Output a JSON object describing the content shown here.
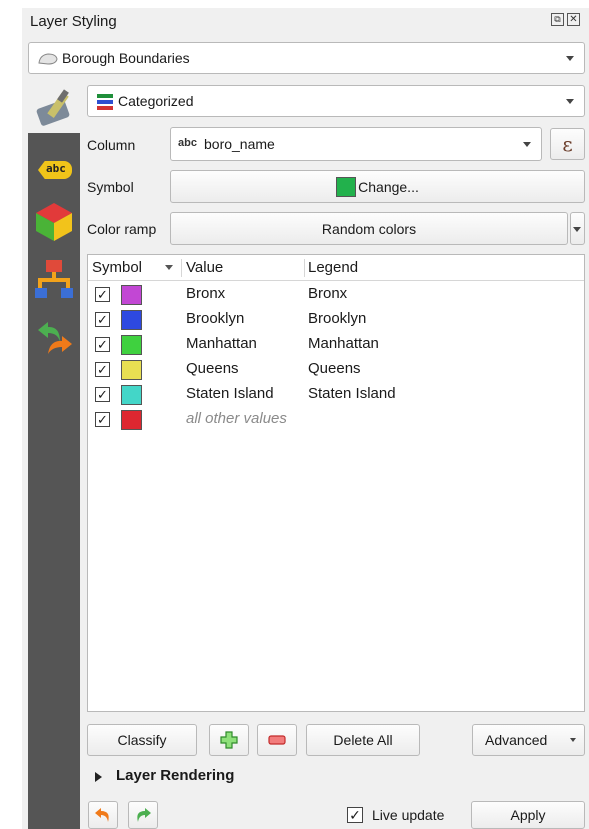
{
  "panel": {
    "title": "Layer Styling"
  },
  "layer_select": {
    "value": "Borough Boundaries"
  },
  "renderer_select": {
    "value": "Categorized"
  },
  "column": {
    "label": "Column",
    "type_tag": "abc",
    "value": "boro_name",
    "expr_symbol": "ε"
  },
  "symbol": {
    "label": "Symbol",
    "change_label": "Change...",
    "color": "#22b14c"
  },
  "color_ramp": {
    "label": "Color ramp",
    "value": "Random colors"
  },
  "side_tabs": [
    {
      "icon": "labels-abc-icon",
      "text": "abc"
    },
    {
      "icon": "3d-cube-icon"
    },
    {
      "icon": "diagram-icon"
    },
    {
      "icon": "history-arrows-icon"
    }
  ],
  "table": {
    "headers": [
      "Symbol",
      "Value",
      "Legend"
    ],
    "rows": [
      {
        "checked": true,
        "color": "#c247d4",
        "value": "Bronx",
        "legend": "Bronx"
      },
      {
        "checked": true,
        "color": "#2e49e0",
        "value": "Brooklyn",
        "legend": "Brooklyn"
      },
      {
        "checked": true,
        "color": "#3fd13f",
        "value": "Manhattan",
        "legend": "Manhattan"
      },
      {
        "checked": true,
        "color": "#e8df52",
        "value": "Queens",
        "legend": "Queens"
      },
      {
        "checked": true,
        "color": "#43d6c8",
        "value": "Staten Island",
        "legend": "Staten Island"
      },
      {
        "checked": true,
        "color": "#dd2730",
        "value": "all other values",
        "legend": ""
      }
    ]
  },
  "buttons": {
    "classify": "Classify",
    "delete_all": "Delete All",
    "advanced": "Advanced",
    "apply": "Apply"
  },
  "layer_rendering": {
    "label": "Layer Rendering"
  },
  "live_update": {
    "label": "Live update",
    "checked": true
  }
}
